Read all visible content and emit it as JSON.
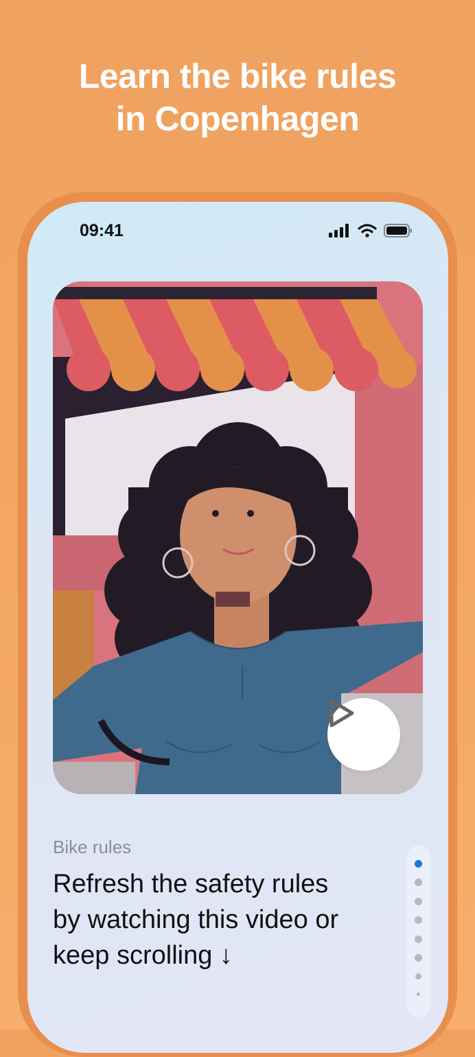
{
  "headline": {
    "line1": "Learn the bike rules",
    "line2": "in Copenhagen"
  },
  "status_bar": {
    "time": "09:41",
    "icons": [
      "signal-icon",
      "wifi-icon",
      "battery-icon"
    ]
  },
  "video": {
    "illustration": "woman-with-curly-hair-under-striped-awning",
    "play_icon": "play-icon"
  },
  "content": {
    "category": "Bike rules",
    "caption_line1": "Refresh the safety rules",
    "caption_line2": "by watching this video or",
    "caption_line3": "keep scrolling ↓"
  },
  "pager": {
    "total": 8,
    "active_index": 0
  },
  "colors": {
    "background": "#f0a45f",
    "accent": "#1a73e8",
    "headline": "#ffffff"
  }
}
